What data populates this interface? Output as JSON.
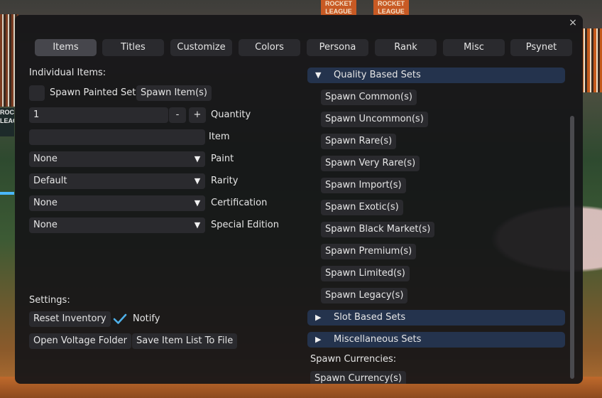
{
  "background": {
    "signs": [
      "ROCKET LEAGUE",
      "ROCKET LEAGUE"
    ],
    "left_logo": "ROCKET LEAGUE"
  },
  "window": {
    "close_label": "×"
  },
  "tabs": [
    {
      "label": "Items",
      "active": true
    },
    {
      "label": "Titles",
      "active": false
    },
    {
      "label": "Customize",
      "active": false
    },
    {
      "label": "Colors",
      "active": false
    },
    {
      "label": "Persona",
      "active": false
    },
    {
      "label": "Rank",
      "active": false
    },
    {
      "label": "Misc",
      "active": false
    },
    {
      "label": "Psynet",
      "active": false
    }
  ],
  "left": {
    "section_title": "Individual Items:",
    "spawn_painted_set_label": "Spawn Painted Set",
    "spawn_items_button": "Spawn Item(s)",
    "quantity": {
      "value": "1",
      "minus": "-",
      "plus": "+",
      "label": "Quantity"
    },
    "item": {
      "value": "",
      "label": "Item"
    },
    "paint": {
      "value": "None",
      "label": "Paint"
    },
    "rarity": {
      "value": "Default",
      "label": "Rarity"
    },
    "certification": {
      "value": "None",
      "label": "Certification"
    },
    "special_edition": {
      "value": "None",
      "label": "Special Edition"
    },
    "dropdown_arrow": "▼",
    "settings_title": "Settings:",
    "reset_inventory_button": "Reset Inventory",
    "notify_label": "Notify",
    "notify_checked": true,
    "open_folder_button": "Open Voltage Folder",
    "save_list_button": "Save Item List To File"
  },
  "right": {
    "quality_header": {
      "label": "Quality Based Sets",
      "expanded_icon": "▼"
    },
    "quality_items": [
      "Spawn Common(s)",
      "Spawn Uncommon(s)",
      "Spawn Rare(s)",
      "Spawn Very Rare(s)",
      "Spawn Import(s)",
      "Spawn Exotic(s)",
      "Spawn Black Market(s)",
      "Spawn Premium(s)",
      "Spawn Limited(s)",
      "Spawn Legacy(s)"
    ],
    "slot_header": {
      "label": "Slot Based Sets",
      "collapsed_icon": "▶"
    },
    "misc_header": {
      "label": "Miscellaneous Sets",
      "collapsed_icon": "▶"
    },
    "currencies_title": "Spawn Currencies:",
    "currency_partial": "Spawn Currency(s)"
  },
  "colors": {
    "accent_header": "#24334d",
    "check": "#4fb0e8"
  }
}
